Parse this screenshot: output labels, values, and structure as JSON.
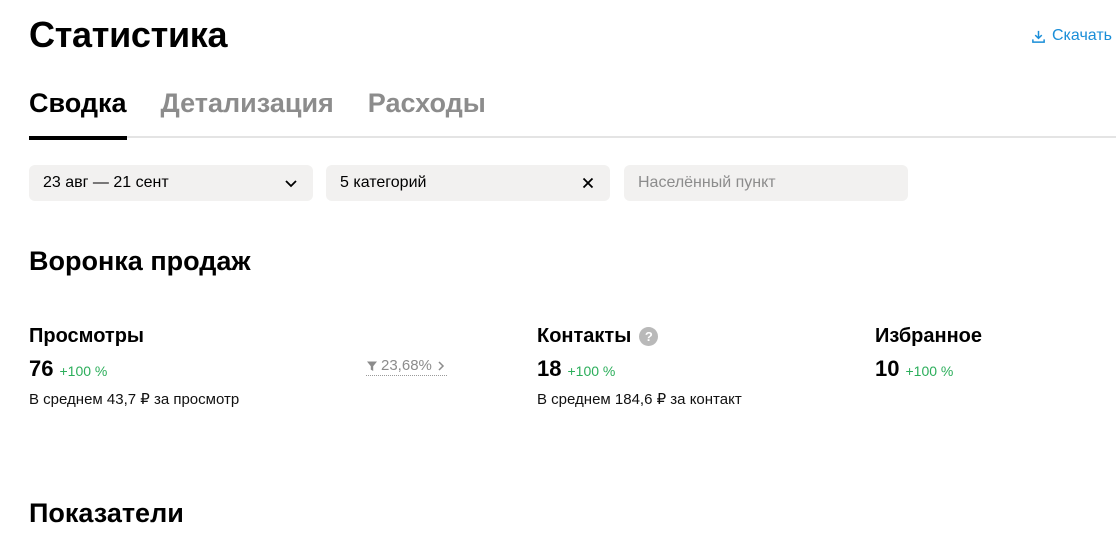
{
  "header": {
    "title": "Статистика",
    "download_label": "Скачать"
  },
  "tabs": [
    {
      "label": "Сводка",
      "active": true
    },
    {
      "label": "Детализация",
      "active": false
    },
    {
      "label": "Расходы",
      "active": false
    }
  ],
  "filters": {
    "date_range": "23 авг — 21 сент",
    "categories": "5 категорий",
    "city_placeholder": "Населённый пункт"
  },
  "funnel": {
    "title": "Воронка продаж",
    "views": {
      "label": "Просмотры",
      "value": "76",
      "delta": "+100 %",
      "avg": "В среднем 43,7 ₽ за просмотр"
    },
    "conversion": "23,68%",
    "contacts": {
      "label": "Контакты",
      "value": "18",
      "delta": "+100 %",
      "avg": "В среднем 184,6 ₽ за контакт",
      "help": "?"
    },
    "favorites": {
      "label": "Избранное",
      "value": "10",
      "delta": "+100 %"
    }
  },
  "metrics": {
    "title": "Показатели"
  },
  "colors": {
    "link": "#1a8ed8",
    "positive": "#2cae5b",
    "muted": "#8c8c8c",
    "chip_bg": "#f2f1f0"
  },
  "icons": {
    "download": "download-icon",
    "chevron": "chevron-down-icon",
    "close": "close-icon",
    "filter": "funnel-icon",
    "chevron_right": "chevron-right-icon",
    "help": "help-icon"
  }
}
